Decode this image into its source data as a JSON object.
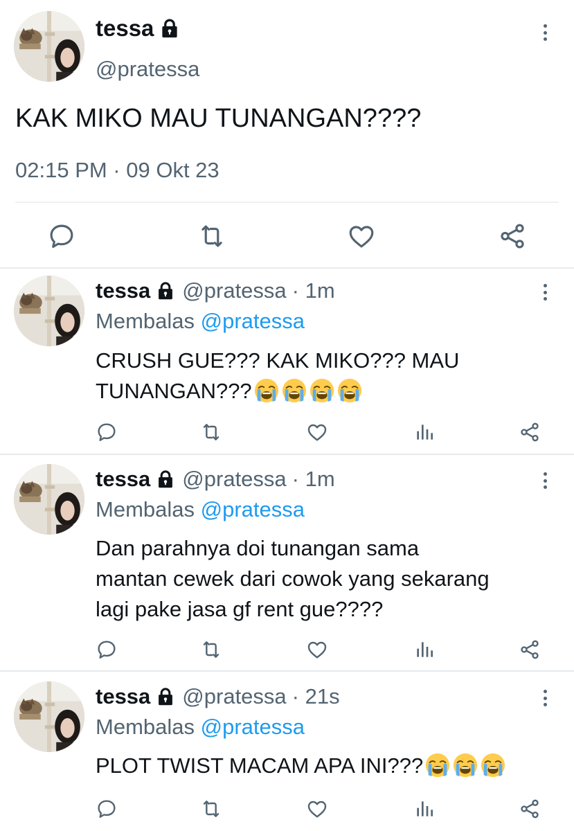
{
  "main_tweet": {
    "name": "tessa",
    "handle": "@pratessa",
    "text": "KAK MIKO MAU TUNANGAN????",
    "timestamp": "02:15 PM · 09 Okt 23",
    "actions": [
      "reply-icon",
      "retweet-icon",
      "like-icon",
      "share-icon"
    ]
  },
  "replies": [
    {
      "name": "tessa",
      "handle": "@pratessa",
      "time": "· 1m",
      "replying_label": "Membalas",
      "replying_to": "@pratessa",
      "text_lines": [
        "CRUSH GUE??? KAK MIKO??? MAU",
        "TUNANGAN???"
      ],
      "emoji_count": 4,
      "emoji": "loudly-crying-face"
    },
    {
      "name": "tessa",
      "handle": "@pratessa",
      "time": "· 1m",
      "replying_label": "Membalas",
      "replying_to": "@pratessa",
      "text_lines": [
        "Dan parahnya doi tunangan sama",
        "mantan cewek dari cowok yang sekarang",
        "lagi pake jasa gf rent gue????"
      ],
      "emoji_count": 0
    },
    {
      "name": "tessa",
      "handle": "@pratessa",
      "time": "· 21s",
      "replying_label": "Membalas",
      "replying_to": "@pratessa",
      "text_lines": [
        "PLOT TWIST MACAM APA INI???"
      ],
      "emoji_count": 3,
      "emoji": "loudly-crying-face"
    }
  ],
  "colors": {
    "text": "#0f1419",
    "secondary": "#536471",
    "mention": "#1d9bf0",
    "divider": "#e6e9ec"
  }
}
